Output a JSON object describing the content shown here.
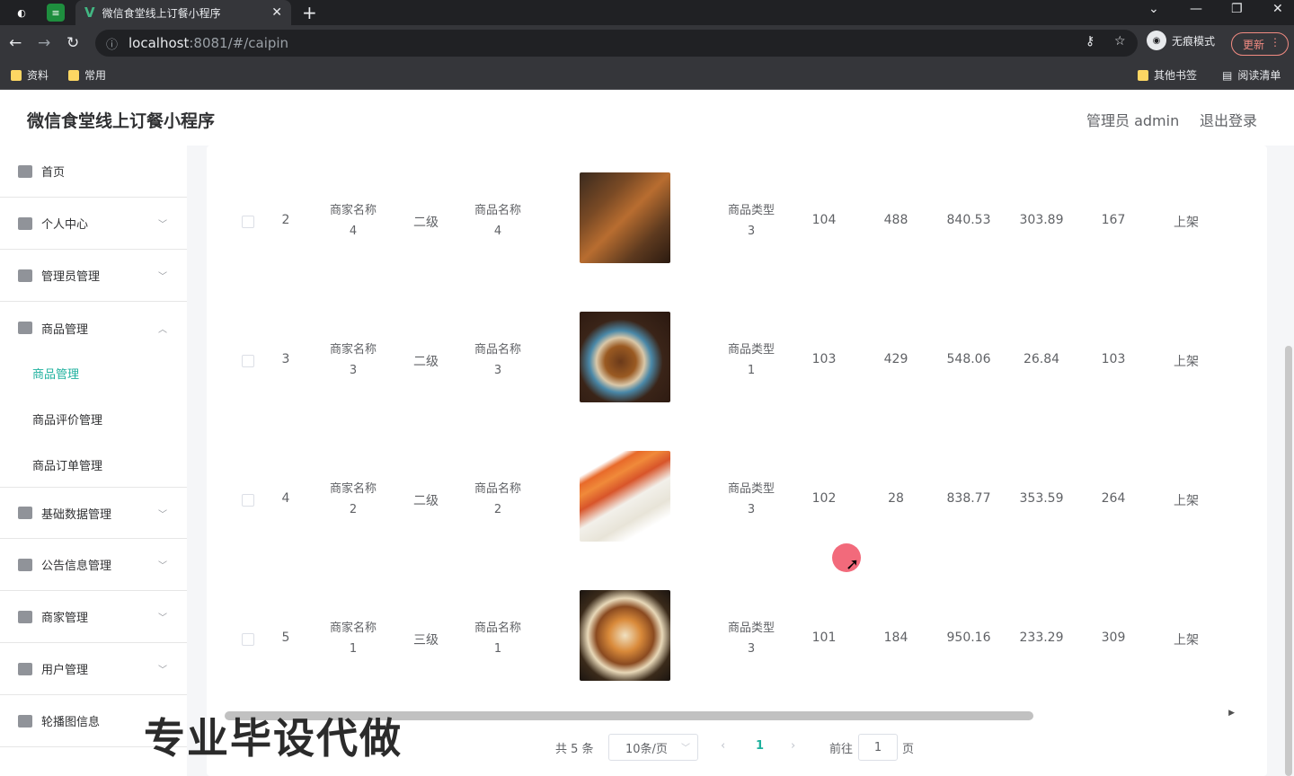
{
  "browser": {
    "tab_title": "微信食堂线上订餐小程序",
    "tab_close": "✕",
    "new_tab": "+",
    "url_host": "localhost",
    "url_path": ":8081/#/caipin",
    "incognito_label": "无痕模式",
    "update_label": "更新",
    "bookmarks": [
      "资料",
      "常用"
    ],
    "other_bookmarks": "其他书签",
    "reading_list": "阅读清单"
  },
  "header": {
    "title": "微信食堂线上订餐小程序",
    "admin": "管理员 admin",
    "logout": "退出登录"
  },
  "sidebar": {
    "items": [
      {
        "label": "首页"
      },
      {
        "label": "个人中心"
      },
      {
        "label": "管理员管理"
      },
      {
        "label": "商品管理"
      },
      {
        "label": "基础数据管理"
      },
      {
        "label": "公告信息管理"
      },
      {
        "label": "商家管理"
      },
      {
        "label": "用户管理"
      },
      {
        "label": "轮播图信息"
      }
    ],
    "sub_items": [
      {
        "label": "商品管理",
        "active": true
      },
      {
        "label": "商品评价管理"
      },
      {
        "label": "商品订单管理"
      }
    ]
  },
  "table": {
    "rows": [
      {
        "index": "2",
        "merchant_a": "商家名称",
        "merchant_b": "4",
        "level": "二级",
        "product_a": "商品名称",
        "product_b": "4",
        "type_a": "商品类型",
        "type_b": "3",
        "c1": "104",
        "c2": "488",
        "c3": "840.53",
        "c4": "303.89",
        "c5": "167",
        "status": "上架",
        "image": "grilled-meat"
      },
      {
        "index": "3",
        "merchant_a": "商家名称",
        "merchant_b": "3",
        "level": "二级",
        "product_a": "商品名称",
        "product_b": "3",
        "type_a": "商品类型",
        "type_b": "1",
        "c1": "103",
        "c2": "429",
        "c3": "548.06",
        "c4": "26.84",
        "c5": "103",
        "status": "上架",
        "image": "noodle-bowl"
      },
      {
        "index": "4",
        "merchant_a": "商家名称",
        "merchant_b": "2",
        "level": "二级",
        "product_a": "商品名称",
        "product_b": "2",
        "type_a": "商品类型",
        "type_b": "3",
        "c1": "102",
        "c2": "28",
        "c3": "838.77",
        "c4": "353.59",
        "c5": "264",
        "status": "上架",
        "image": "sushi-roll"
      },
      {
        "index": "5",
        "merchant_a": "商家名称",
        "merchant_b": "1",
        "level": "三级",
        "product_a": "商品名称",
        "product_b": "1",
        "type_a": "商品类型",
        "type_b": "3",
        "c1": "101",
        "c2": "184",
        "c3": "950.16",
        "c4": "233.29",
        "c5": "309",
        "status": "上架",
        "image": "sushi-platter"
      }
    ]
  },
  "pagination": {
    "total": "共 5 条",
    "page_size": "10条/页",
    "current": "1",
    "goto_label": "前往",
    "goto_value": "1",
    "goto_unit": "页"
  },
  "watermark": "专业毕设代做",
  "colors": {
    "accent": "#1fb19e"
  }
}
